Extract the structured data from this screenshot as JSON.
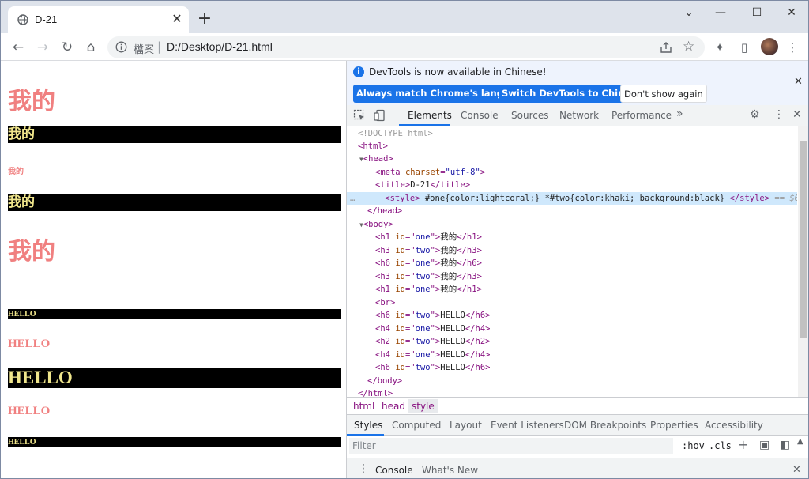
{
  "tab": {
    "title": "D-21"
  },
  "address": {
    "scheme": "檔案",
    "separator": "|",
    "url": "D:/Desktop/D-21.html"
  },
  "page": {
    "items": [
      {
        "text": "我的",
        "id": "one",
        "tag": "h1"
      },
      {
        "text": "我的",
        "id": "two",
        "tag": "h3"
      },
      {
        "text": "我的",
        "id": "one",
        "tag": "h6"
      },
      {
        "text": "我的",
        "id": "two",
        "tag": "h3"
      },
      {
        "text": "我的",
        "id": "one",
        "tag": "h1"
      },
      {
        "text": "HELLO",
        "id": "two",
        "tag": "h6"
      },
      {
        "text": "HELLO",
        "id": "one",
        "tag": "h4"
      },
      {
        "text": "HELLO",
        "id": "two",
        "tag": "h2"
      },
      {
        "text": "HELLO",
        "id": "one",
        "tag": "h4"
      },
      {
        "text": "HELLO",
        "id": "two",
        "tag": "h6"
      }
    ]
  },
  "devtools": {
    "banner": {
      "message": "DevTools is now available in Chinese!",
      "btn_match": "Always match Chrome's language",
      "btn_switch": "Switch DevTools to Chinese",
      "btn_dismiss": "Don't show again"
    },
    "tabs": [
      "Elements",
      "Console",
      "Sources",
      "Network",
      "Performance"
    ],
    "more": "»",
    "dom": {
      "doctype": "<!DOCTYPE html>",
      "html_open": "<html>",
      "head_open": "<head>",
      "meta_tag": "meta",
      "meta_attr": "charset",
      "meta_val": "\"utf-8\"",
      "title_text": "D-21",
      "style_text": "#one{color:lightcoral;} *#two{color:khaki; background:black}",
      "selected_marker": "== $0",
      "dots": "…",
      "head_close": "</head>",
      "body_open": "<body>",
      "br": "<br>",
      "body_close": "</body>",
      "html_close": "</html>"
    },
    "breadcrumbs": [
      "html",
      "head",
      "style"
    ],
    "subtabs": [
      "Styles",
      "Computed",
      "Layout",
      "Event Listeners",
      "DOM Breakpoints",
      "Properties",
      "Accessibility"
    ],
    "filter": {
      "placeholder": "Filter",
      "hov": ":hov",
      "cls": ".cls",
      "plus": "+"
    },
    "drawer": [
      "Console",
      "What's New"
    ]
  },
  "colors": {
    "lightcoral": "#f08080",
    "khaki": "#f0e68c",
    "accent": "#1a73e8"
  }
}
